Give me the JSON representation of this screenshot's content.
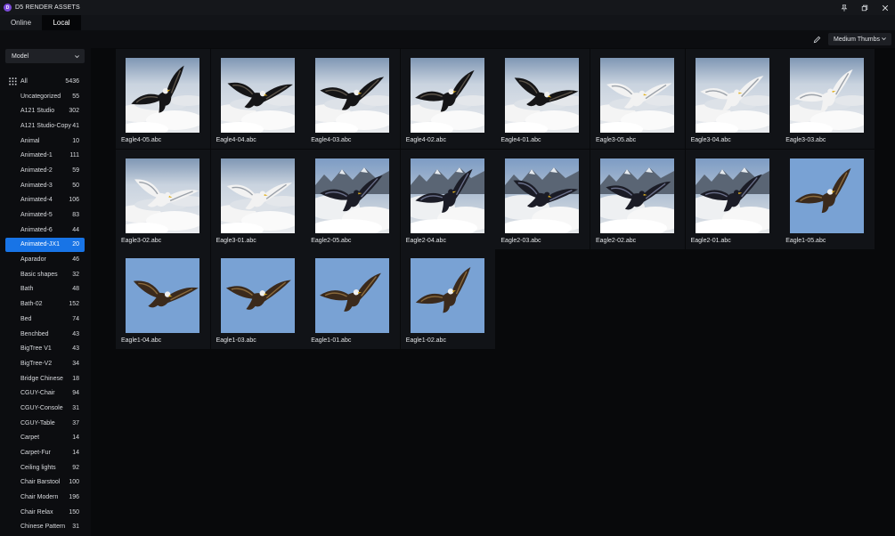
{
  "app": {
    "title": "D5 RENDER ASSETS",
    "logo_letter": "D"
  },
  "tabs": [
    {
      "label": "Online"
    },
    {
      "label": "Local"
    }
  ],
  "toolbar": {
    "thumb_size": "Medium Thumbs"
  },
  "sidebar": {
    "dropdown": "Model",
    "categories": [
      {
        "label": "All",
        "count": "5436"
      },
      {
        "label": "Uncategorized",
        "count": "55"
      },
      {
        "label": "A121 Studio",
        "count": "302"
      },
      {
        "label": "A121 Studio-Copy",
        "count": "41"
      },
      {
        "label": "Animal",
        "count": "10"
      },
      {
        "label": "Animated-1",
        "count": "111"
      },
      {
        "label": "Animated-2",
        "count": "59"
      },
      {
        "label": "Animated-3",
        "count": "50"
      },
      {
        "label": "Animated-4",
        "count": "106"
      },
      {
        "label": "Animated-5",
        "count": "83"
      },
      {
        "label": "Animated-6",
        "count": "44"
      },
      {
        "label": "Animated-JX1",
        "count": "20",
        "selected": true
      },
      {
        "label": "Aparador",
        "count": "46"
      },
      {
        "label": "Basic shapes",
        "count": "32"
      },
      {
        "label": "Bath",
        "count": "48"
      },
      {
        "label": "Bath-02",
        "count": "152"
      },
      {
        "label": "Bed",
        "count": "74"
      },
      {
        "label": "Benchbed",
        "count": "43"
      },
      {
        "label": "BigTree V1",
        "count": "43"
      },
      {
        "label": "BigTree-V2",
        "count": "34"
      },
      {
        "label": "Bridge Chinese",
        "count": "18"
      },
      {
        "label": "CGUY-Chair",
        "count": "94"
      },
      {
        "label": "CGUY-Console",
        "count": "31"
      },
      {
        "label": "CGUY-Table",
        "count": "37"
      },
      {
        "label": "Carpet",
        "count": "14"
      },
      {
        "label": "Carpet-Fur",
        "count": "14"
      },
      {
        "label": "Ceiling lights",
        "count": "92"
      },
      {
        "label": "Chair Barstool",
        "count": "100"
      },
      {
        "label": "Chair Modern",
        "count": "196"
      },
      {
        "label": "Chair Relax",
        "count": "150"
      },
      {
        "label": "Chinese Pattern",
        "count": "31"
      }
    ]
  },
  "assets": [
    {
      "name": "Eagle4-05.abc",
      "bg": "clouds",
      "bird": "dark"
    },
    {
      "name": "Eagle4-04.abc",
      "bg": "clouds",
      "bird": "dark"
    },
    {
      "name": "Eagle4-03.abc",
      "bg": "clouds",
      "bird": "dark"
    },
    {
      "name": "Eagle4-02.abc",
      "bg": "clouds",
      "bird": "dark"
    },
    {
      "name": "Eagle4-01.abc",
      "bg": "clouds",
      "bird": "dark"
    },
    {
      "name": "Eagle3-05.abc",
      "bg": "clouds",
      "bird": "white"
    },
    {
      "name": "Eagle3-04.abc",
      "bg": "clouds",
      "bird": "white"
    },
    {
      "name": "Eagle3-03.abc",
      "bg": "clouds",
      "bird": "white"
    },
    {
      "name": "Eagle3-02.abc",
      "bg": "clouds",
      "bird": "white"
    },
    {
      "name": "Eagle3-01.abc",
      "bg": "clouds",
      "bird": "white"
    },
    {
      "name": "Eagle2-05.abc",
      "bg": "mountains",
      "bird": "black"
    },
    {
      "name": "Eagle2-04.abc",
      "bg": "mountains",
      "bird": "black"
    },
    {
      "name": "Eagle2-03.abc",
      "bg": "mountains",
      "bird": "black"
    },
    {
      "name": "Eagle2-02.abc",
      "bg": "mountains",
      "bird": "black"
    },
    {
      "name": "Eagle2-01.abc",
      "bg": "mountains",
      "bird": "black"
    },
    {
      "name": "Eagle1-05.abc",
      "bg": "sky",
      "bird": "brown"
    },
    {
      "name": "Eagle1-04.abc",
      "bg": "sky",
      "bird": "brown"
    },
    {
      "name": "Eagle1-03.abc",
      "bg": "sky",
      "bird": "brown"
    },
    {
      "name": "Eagle1-01.abc",
      "bg": "sky",
      "bird": "brown"
    },
    {
      "name": "Eagle1-02.abc",
      "bg": "sky",
      "bird": "brown"
    }
  ],
  "colors": {
    "accent": "#1874e6",
    "background": "#08090b",
    "card": "#111317",
    "sky": "#6e9ad0"
  }
}
